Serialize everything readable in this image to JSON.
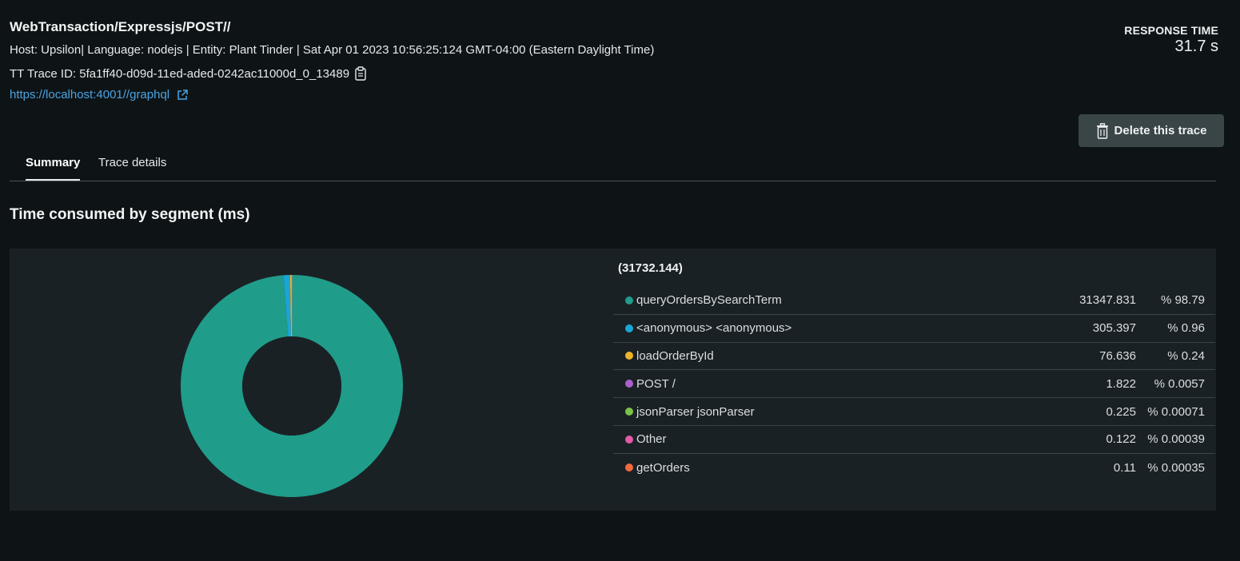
{
  "header": {
    "title": "WebTransaction/Expressjs/POST//",
    "meta": "Host: Upsilon| Language: nodejs | Entity: Plant Tinder | Sat Apr 01 2023 10:56:25:124 GMT-04:00 (Eastern Daylight Time)",
    "trace_id": "TT Trace ID: 5fa1ff40-d09d-11ed-aded-0242ac11000d_0_13489",
    "url": "https://localhost:4001//graphql",
    "response_time_label": "RESPONSE TIME",
    "response_time_value": "31.7 s",
    "delete_label": "Delete this trace"
  },
  "tabs": [
    {
      "label": "Summary",
      "active": true
    },
    {
      "label": "Trace details",
      "active": false
    }
  ],
  "section_title": "Time consumed by segment (ms)",
  "colors": {
    "accent_link": "#4ba3e3",
    "background": "#0e1416",
    "panel": "#1a2124"
  },
  "chart_data": {
    "type": "pie",
    "total_label": "(31732.144)",
    "donut": true,
    "segments": [
      {
        "label": "queryOrdersBySearchTerm",
        "value": 31347.831,
        "value_text": "31347.831",
        "percent_text": "98.79 %",
        "color": "#209c8a"
      },
      {
        "label": "<anonymous> <anonymous>",
        "value": 305.397,
        "value_text": "305.397",
        "percent_text": "0.96 %",
        "color": "#1aa5d6"
      },
      {
        "label": "loadOrderById",
        "value": 76.636,
        "value_text": "76.636",
        "percent_text": "0.24 %",
        "color": "#f0b429"
      },
      {
        "label": "POST /",
        "value": 1.822,
        "value_text": "1.822",
        "percent_text": "0.0057 %",
        "color": "#a960c9"
      },
      {
        "label": "jsonParser jsonParser",
        "value": 0.225,
        "value_text": "0.225",
        "percent_text": "0.00071 %",
        "color": "#7cc24a"
      },
      {
        "label": "Other",
        "value": 0.122,
        "value_text": "0.122",
        "percent_text": "0.00039 %",
        "color": "#e05aa8"
      },
      {
        "label": "getOrders",
        "value": 0.11,
        "value_text": "0.11",
        "percent_text": "0.00035 %",
        "color": "#f06a3e"
      }
    ]
  }
}
